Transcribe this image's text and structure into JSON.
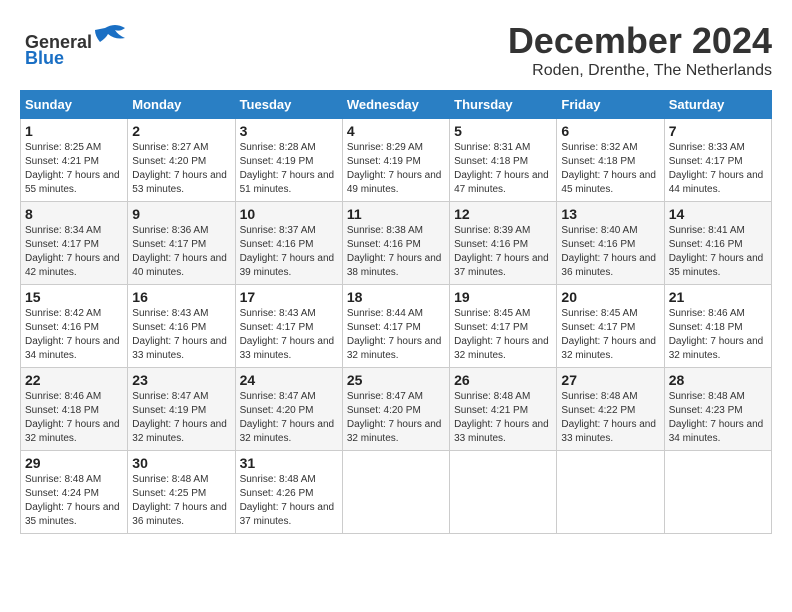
{
  "header": {
    "logo_general": "General",
    "logo_blue": "Blue",
    "month_title": "December 2024",
    "location": "Roden, Drenthe, The Netherlands"
  },
  "days_of_week": [
    "Sunday",
    "Monday",
    "Tuesday",
    "Wednesday",
    "Thursday",
    "Friday",
    "Saturday"
  ],
  "weeks": [
    [
      {
        "day": "1",
        "sunrise": "8:25 AM",
        "sunset": "4:21 PM",
        "daylight": "7 hours and 55 minutes."
      },
      {
        "day": "2",
        "sunrise": "8:27 AM",
        "sunset": "4:20 PM",
        "daylight": "7 hours and 53 minutes."
      },
      {
        "day": "3",
        "sunrise": "8:28 AM",
        "sunset": "4:19 PM",
        "daylight": "7 hours and 51 minutes."
      },
      {
        "day": "4",
        "sunrise": "8:29 AM",
        "sunset": "4:19 PM",
        "daylight": "7 hours and 49 minutes."
      },
      {
        "day": "5",
        "sunrise": "8:31 AM",
        "sunset": "4:18 PM",
        "daylight": "7 hours and 47 minutes."
      },
      {
        "day": "6",
        "sunrise": "8:32 AM",
        "sunset": "4:18 PM",
        "daylight": "7 hours and 45 minutes."
      },
      {
        "day": "7",
        "sunrise": "8:33 AM",
        "sunset": "4:17 PM",
        "daylight": "7 hours and 44 minutes."
      }
    ],
    [
      {
        "day": "8",
        "sunrise": "8:34 AM",
        "sunset": "4:17 PM",
        "daylight": "7 hours and 42 minutes."
      },
      {
        "day": "9",
        "sunrise": "8:36 AM",
        "sunset": "4:17 PM",
        "daylight": "7 hours and 40 minutes."
      },
      {
        "day": "10",
        "sunrise": "8:37 AM",
        "sunset": "4:16 PM",
        "daylight": "7 hours and 39 minutes."
      },
      {
        "day": "11",
        "sunrise": "8:38 AM",
        "sunset": "4:16 PM",
        "daylight": "7 hours and 38 minutes."
      },
      {
        "day": "12",
        "sunrise": "8:39 AM",
        "sunset": "4:16 PM",
        "daylight": "7 hours and 37 minutes."
      },
      {
        "day": "13",
        "sunrise": "8:40 AM",
        "sunset": "4:16 PM",
        "daylight": "7 hours and 36 minutes."
      },
      {
        "day": "14",
        "sunrise": "8:41 AM",
        "sunset": "4:16 PM",
        "daylight": "7 hours and 35 minutes."
      }
    ],
    [
      {
        "day": "15",
        "sunrise": "8:42 AM",
        "sunset": "4:16 PM",
        "daylight": "7 hours and 34 minutes."
      },
      {
        "day": "16",
        "sunrise": "8:43 AM",
        "sunset": "4:16 PM",
        "daylight": "7 hours and 33 minutes."
      },
      {
        "day": "17",
        "sunrise": "8:43 AM",
        "sunset": "4:17 PM",
        "daylight": "7 hours and 33 minutes."
      },
      {
        "day": "18",
        "sunrise": "8:44 AM",
        "sunset": "4:17 PM",
        "daylight": "7 hours and 32 minutes."
      },
      {
        "day": "19",
        "sunrise": "8:45 AM",
        "sunset": "4:17 PM",
        "daylight": "7 hours and 32 minutes."
      },
      {
        "day": "20",
        "sunrise": "8:45 AM",
        "sunset": "4:17 PM",
        "daylight": "7 hours and 32 minutes."
      },
      {
        "day": "21",
        "sunrise": "8:46 AM",
        "sunset": "4:18 PM",
        "daylight": "7 hours and 32 minutes."
      }
    ],
    [
      {
        "day": "22",
        "sunrise": "8:46 AM",
        "sunset": "4:18 PM",
        "daylight": "7 hours and 32 minutes."
      },
      {
        "day": "23",
        "sunrise": "8:47 AM",
        "sunset": "4:19 PM",
        "daylight": "7 hours and 32 minutes."
      },
      {
        "day": "24",
        "sunrise": "8:47 AM",
        "sunset": "4:20 PM",
        "daylight": "7 hours and 32 minutes."
      },
      {
        "day": "25",
        "sunrise": "8:47 AM",
        "sunset": "4:20 PM",
        "daylight": "7 hours and 32 minutes."
      },
      {
        "day": "26",
        "sunrise": "8:48 AM",
        "sunset": "4:21 PM",
        "daylight": "7 hours and 33 minutes."
      },
      {
        "day": "27",
        "sunrise": "8:48 AM",
        "sunset": "4:22 PM",
        "daylight": "7 hours and 33 minutes."
      },
      {
        "day": "28",
        "sunrise": "8:48 AM",
        "sunset": "4:23 PM",
        "daylight": "7 hours and 34 minutes."
      }
    ],
    [
      {
        "day": "29",
        "sunrise": "8:48 AM",
        "sunset": "4:24 PM",
        "daylight": "7 hours and 35 minutes."
      },
      {
        "day": "30",
        "sunrise": "8:48 AM",
        "sunset": "4:25 PM",
        "daylight": "7 hours and 36 minutes."
      },
      {
        "day": "31",
        "sunrise": "8:48 AM",
        "sunset": "4:26 PM",
        "daylight": "7 hours and 37 minutes."
      },
      null,
      null,
      null,
      null
    ]
  ]
}
